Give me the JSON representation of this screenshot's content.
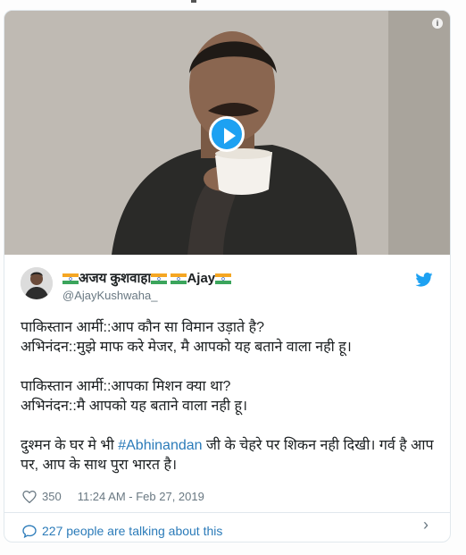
{
  "tweet": {
    "display_name_parts": [
      "अजय कुशवाहा",
      "Ajay"
    ],
    "handle": "@AjayKushwaha_",
    "lines": [
      "पाकिस्तान आर्मी::आप कौन सा विमान उड़ाते है?",
      "अभिनंदन::मुझे माफ करे मेजर, मै आपको यह बताने वाला नही हू।",
      "",
      "पाकिस्तान आर्मी::आपका मिशन क्या था?",
      "अभिनंदन::मै आपको यह बताने वाला नही हू।",
      ""
    ],
    "last_para_before": "दुश्मन के घर मे भी ",
    "hashtag": "#Abhinandan",
    "last_para_after": " जी के चेहरे पर शिकन नही दिखी। गर्व है आप पर, आप के साथ पुरा भारत है।",
    "likes": "350",
    "timestamp": "11:24 AM - Feb 27, 2019",
    "talking": "227 people are talking about this"
  },
  "icons": {
    "info": "info-icon",
    "play": "play-icon",
    "twitter": "twitter-bird-icon",
    "heart": "heart-icon",
    "comment": "speech-bubble-icon",
    "chevron": "chevron-right-icon",
    "flag": "india-flag-icon"
  },
  "colors": {
    "accent": "#1da1f2",
    "link": "#2b7bb9",
    "text": "#1c2022",
    "muted": "#697882"
  }
}
